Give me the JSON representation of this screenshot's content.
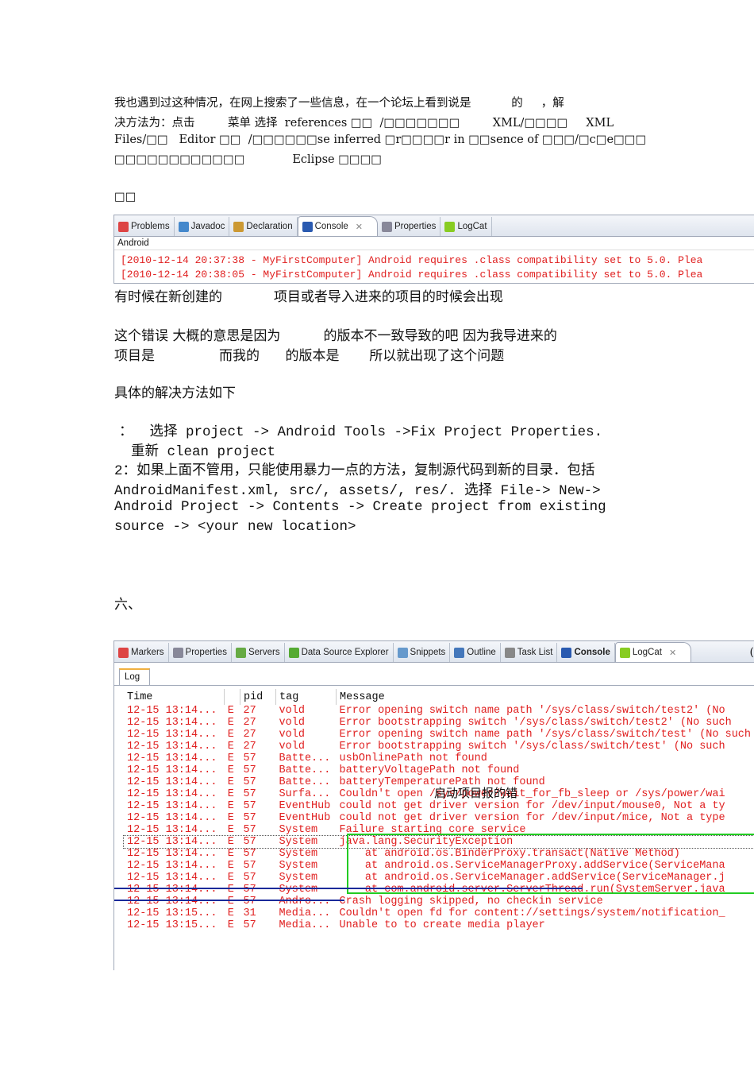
{
  "intro": [
    "我也遇到过这种情况，在网上搜索了一些信息，在一个论坛上看到说是           的     ，解",
    "决方法为：点击         菜单 选择  references □□  /□□□□□□□         XML/□□□□     XML",
    "Files/□□   Editor □□  /□□□□□□se inferred □r□□□□r in □□sence of □□□/□c□e□□□",
    "□□□□□□□□□□□□             Eclipse □□□□"
  ],
  "label1": "□□",
  "panel1": {
    "tabs": [
      "Problems",
      "Javadoc",
      "Declaration",
      "Console",
      "Properties",
      "LogCat"
    ],
    "header": "Android",
    "lines": [
      "[2010-12-14 20:37:38 - MyFirstComputer] Android requires .class compatibility set to 5.0. Plea",
      "[2010-12-14 20:38:05 - MyFirstComputer] Android requires .class compatibility set to 5.0. Plea"
    ]
  },
  "para": [
    "有时候在新创建的            项目或者导入进来的项目的时候会出现",
    "这个错误 大概的意思是因为          的版本不一致导致的吧 因为我导进来的",
    "项目是               而我的      的版本是       所以就出现了这个问题",
    "具体的解决方法如下"
  ],
  "steps": [
    "：  选择 project -> Android Tools ->Fix Project Properties.",
    "  重新 clean project",
    "2：如果上面不管用，只能使用暴力一点的方法，复制源代码到新的目录．包括",
    "AndroidManifest.xml, src/, assets/, res/. 选择 File-> New->",
    "Android Project -> Contents -> Create project from existing",
    "source -> <your new location>"
  ],
  "section": "六、",
  "panel2": {
    "tabs": [
      "Markers",
      "Properties",
      "Servers",
      "Data Source Explorer",
      "Snippets",
      "Outline",
      "Task List",
      "Console",
      "LogCat"
    ],
    "subtab": "Log",
    "columns": [
      "Time",
      "",
      "pid",
      "tag",
      "Message"
    ],
    "rows": [
      [
        "12-15 13:14...",
        "E",
        "27",
        "vold",
        "Error opening switch name path '/sys/class/switch/test2' (No"
      ],
      [
        "12-15 13:14...",
        "E",
        "27",
        "vold",
        "Error bootstrapping switch '/sys/class/switch/test2' (No such"
      ],
      [
        "12-15 13:14...",
        "E",
        "27",
        "vold",
        "Error opening switch name path '/sys/class/switch/test' (No such"
      ],
      [
        "12-15 13:14...",
        "E",
        "27",
        "vold",
        "Error bootstrapping switch '/sys/class/switch/test' (No such"
      ],
      [
        "12-15 13:14...",
        "E",
        "57",
        "Batte...",
        "usbOnlinePath not found"
      ],
      [
        "12-15 13:14...",
        "E",
        "57",
        "Batte...",
        "batteryVoltagePath not found"
      ],
      [
        "12-15 13:14...",
        "E",
        "57",
        "Batte...",
        "batteryTemperaturePath not found"
      ],
      [
        "12-15 13:14...",
        "E",
        "57",
        "Surfa...",
        "Couldn't open /sys/power/wait_for_fb_sleep or /sys/power/wai"
      ],
      [
        "12-15 13:14...",
        "E",
        "57",
        "EventHub",
        "could not get driver version for /dev/input/mouse0, Not a ty"
      ],
      [
        "12-15 13:14...",
        "E",
        "57",
        "EventHub",
        "could not get driver version for /dev/input/mice, Not a type"
      ],
      [
        "12-15 13:14...",
        "E",
        "57",
        "System",
        "Failure starting core service"
      ],
      [
        "12-15 13:14...",
        "E",
        "57",
        "System",
        "java.lang.SecurityException"
      ],
      [
        "12-15 13:14...",
        "E",
        "57",
        "System",
        "    at android.os.BinderProxy.transact(Native Method)"
      ],
      [
        "12-15 13:14...",
        "E",
        "57",
        "System",
        "    at android.os.ServiceManagerProxy.addService(ServiceMana"
      ],
      [
        "12-15 13:14...",
        "E",
        "57",
        "System",
        "    at android.os.ServiceManager.addService(ServiceManager.j"
      ],
      [
        "12-15 13:14...",
        "E",
        "57",
        "System",
        "    at com.android.server.ServerThread.run(SystemServer.java"
      ],
      [
        "12-15 13:14...",
        "E",
        "57",
        "Andro...",
        "Crash logging skipped, no checkin service"
      ],
      [
        "12-15 13:15...",
        "E",
        "31",
        "Media...",
        "Couldn't open fd for content://settings/system/notification_"
      ],
      [
        "12-15 13:15...",
        "E",
        "57",
        "Media...",
        "Unable to to create media player"
      ]
    ],
    "annotation": "启动项目报的错"
  }
}
